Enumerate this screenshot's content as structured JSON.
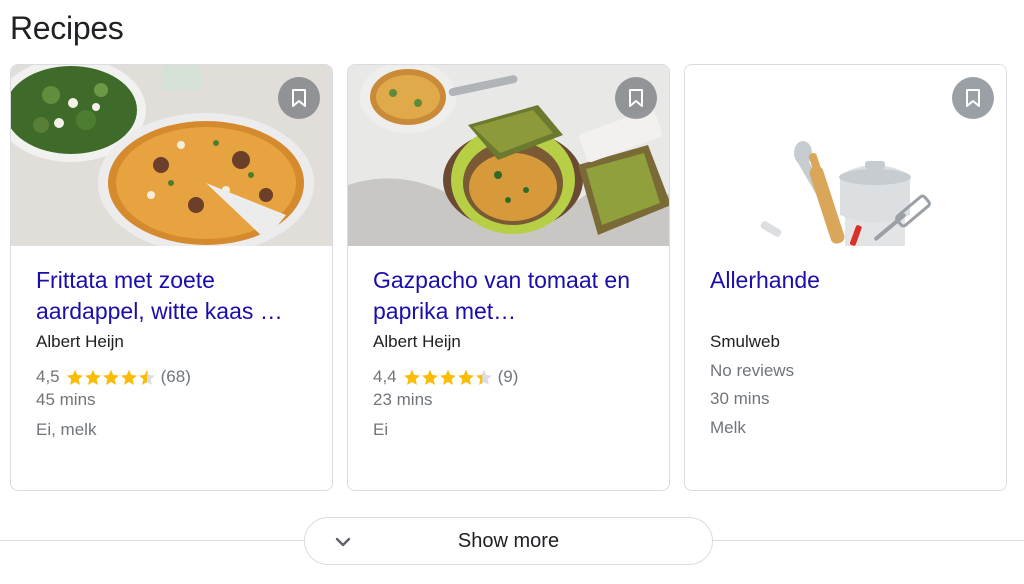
{
  "section": {
    "title": "Recipes"
  },
  "cards": [
    {
      "title": "Frittata met zoete aardappel, witte kaas …",
      "source": "Albert Heijn",
      "rating": "4,5",
      "rating_value": 4.5,
      "review_count": "(68)",
      "time": "45 mins",
      "ingredients": "Ei, melk"
    },
    {
      "title": "Gazpacho van tomaat en paprika met…",
      "source": "Albert Heijn",
      "rating": "4,4",
      "rating_value": 4.4,
      "review_count": "(9)",
      "time": "23 mins",
      "ingredients": "Ei"
    },
    {
      "title": "Allerhande",
      "source": "Smulweb",
      "reviews": "No reviews",
      "time": "30 mins",
      "ingredients": "Melk"
    }
  ],
  "show_more": {
    "label": "Show more"
  },
  "colors": {
    "link": "#1a0dab",
    "star": "#fbbc04",
    "muted": "#70757a",
    "border": "#dadce0"
  },
  "icons": {
    "bookmark": "bookmark-icon",
    "chevron": "chevron-down-icon",
    "star": "star-icon"
  }
}
